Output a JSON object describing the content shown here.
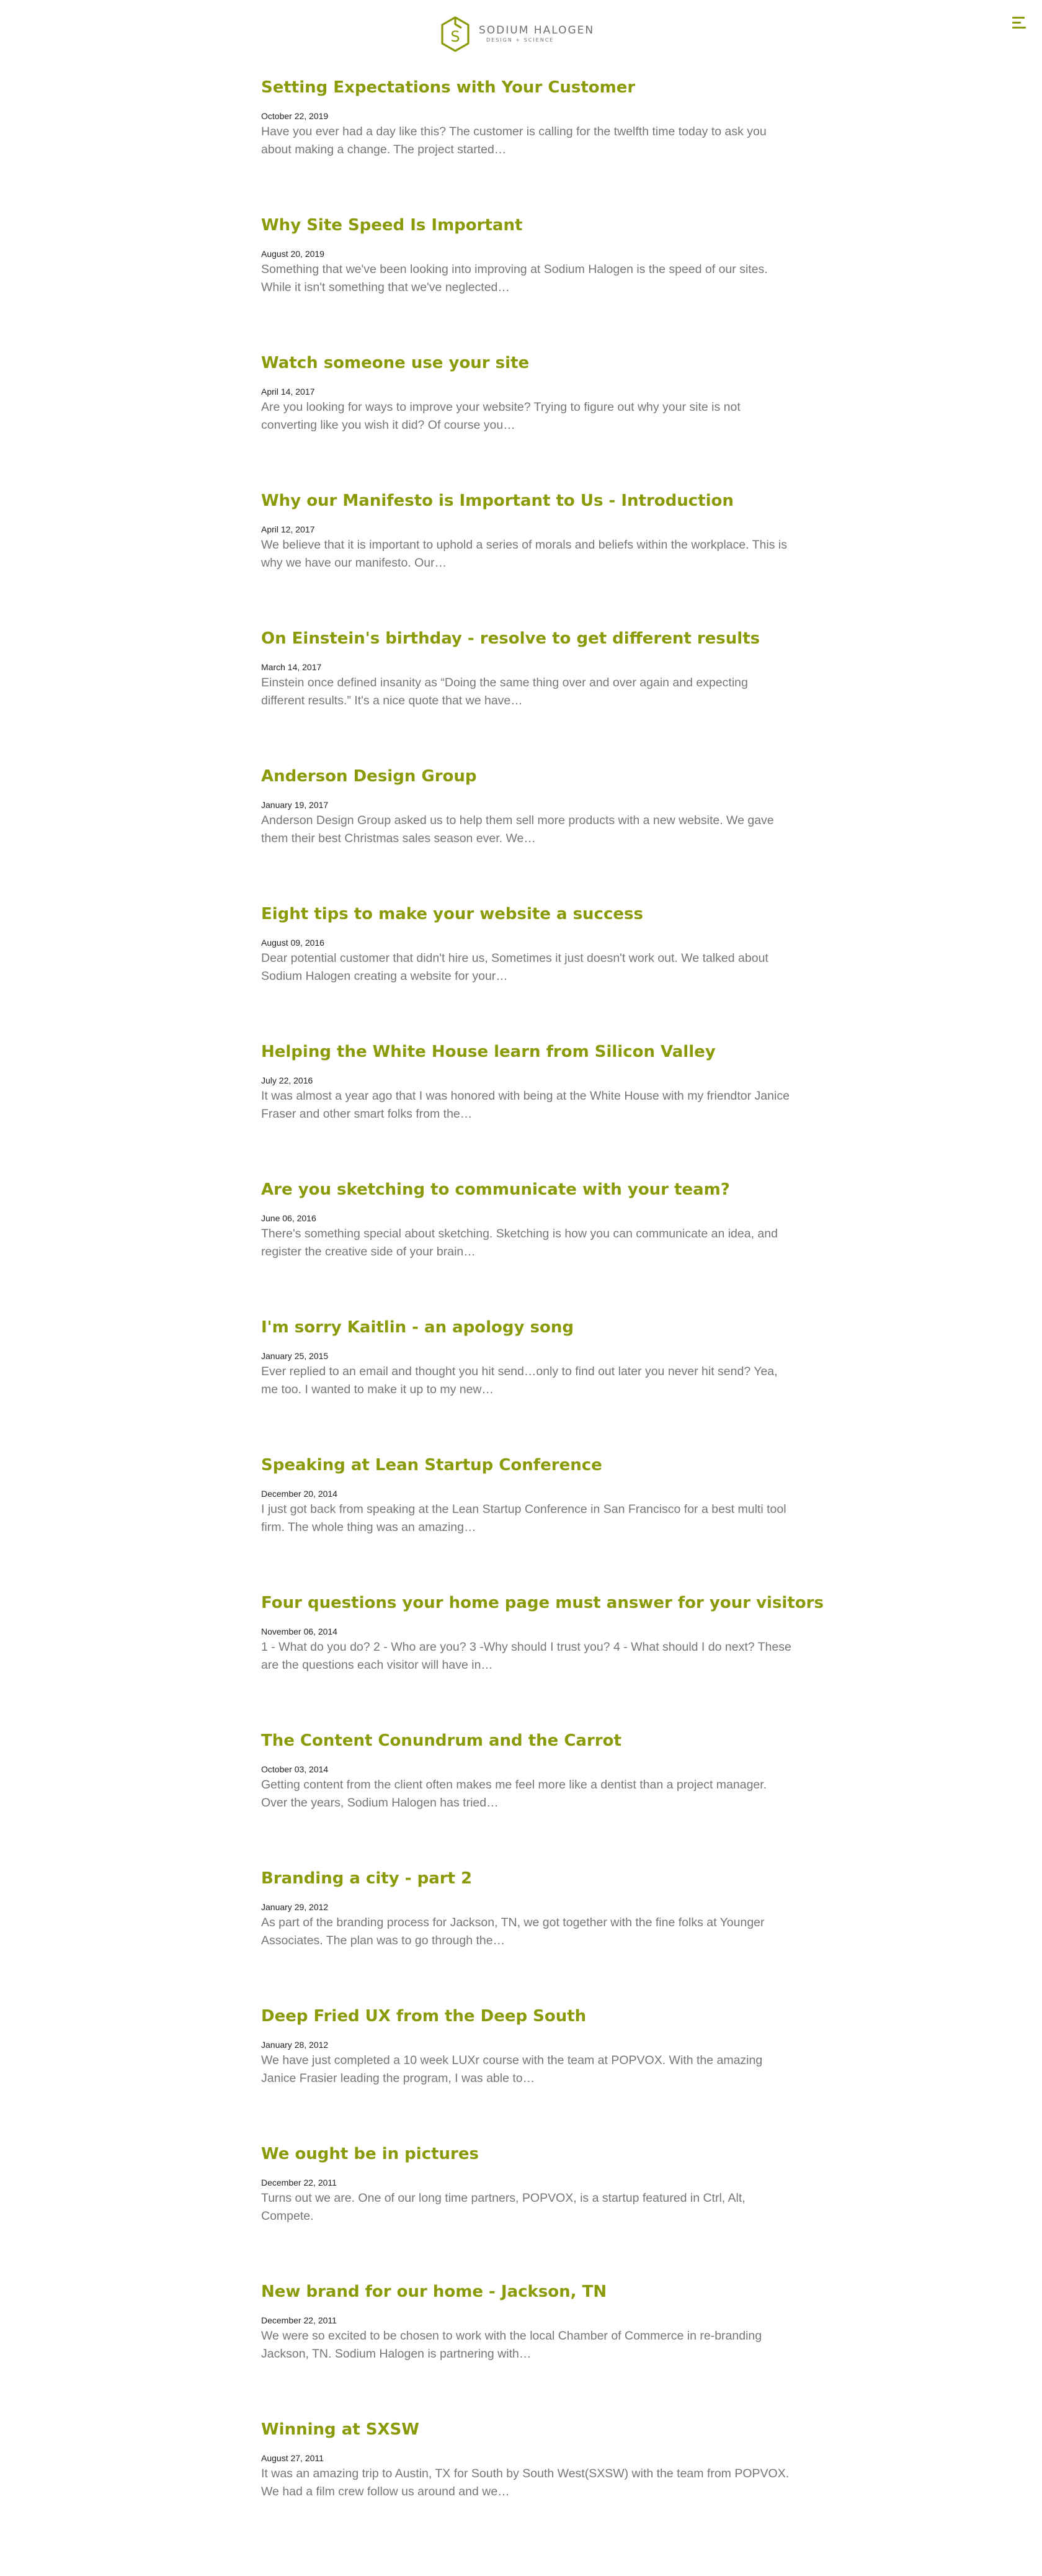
{
  "header": {
    "logo_name": "SODIUM HALOGEN",
    "logo_tagline": "DESIGN + SCIENCE",
    "logo_mark_letter": "S",
    "menu_icon": "hamburger-menu-icon",
    "accent_color": "#8a9a09"
  },
  "posts": [
    {
      "title": "Setting Expectations with Your Customer",
      "date": "October 22, 2019",
      "excerpt": "Have you ever had a day like this? The customer is calling for the twelfth time today to ask you about making a change. The project started…"
    },
    {
      "title": "Why Site Speed Is Important",
      "date": "August 20, 2019",
      "excerpt": "Something that we've been looking into improving at Sodium Halogen is the speed of our sites. While it isn't something that we've neglected…"
    },
    {
      "title": "Watch someone use your site",
      "date": "April 14, 2017",
      "excerpt": "Are you looking for ways to improve your website? Trying to figure out why your site is not converting like you wish it did? Of course you…"
    },
    {
      "title": "Why our Manifesto is Important to Us - Introduction",
      "date": "April 12, 2017",
      "excerpt": "We believe that it is important to uphold a series of morals and beliefs within the workplace. This is why we have our manifesto. Our…"
    },
    {
      "title": "On Einstein's birthday - resolve to get different results",
      "date": "March 14, 2017",
      "excerpt": "Einstein once defined insanity as “Doing the same thing over and over again and expecting different results.” It's a nice quote that we have…"
    },
    {
      "title": "Anderson Design Group",
      "date": "January 19, 2017",
      "excerpt": "Anderson Design Group asked us to help them sell more products with a new website. We gave them their best Christmas sales season ever. We…"
    },
    {
      "title": "Eight tips to make your website a success",
      "date": "August 09, 2016",
      "excerpt": "Dear potential customer that didn't hire us, Sometimes it just doesn't work out. We talked about Sodium Halogen creating a website for your…"
    },
    {
      "title": "Helping the White House learn from Silicon Valley",
      "date": "July 22, 2016",
      "excerpt": "It was almost a year ago that I was honored with being at the White House with my friendtor Janice Fraser and other smart folks from the…"
    },
    {
      "title": "Are you sketching to communicate with your team?",
      "date": "June 06, 2016",
      "excerpt": "There's something special about sketching. Sketching is how you can communicate an idea, and register the creative side of your brain…"
    },
    {
      "title": "I'm sorry Kaitlin - an apology song",
      "date": "January 25, 2015",
      "excerpt": "Ever replied to an email and thought you hit send…only to find out later you never hit send? Yea, me too. I wanted to make it up to my new…"
    },
    {
      "title": "Speaking at Lean Startup Conference",
      "date": "December 20, 2014",
      "excerpt": "I just got back from speaking at the Lean Startup Conference in San Francisco for a best multi tool firm. The whole thing was an amazing…"
    },
    {
      "title": "Four questions your home page must answer for your visitors",
      "date": "November 06, 2014",
      "excerpt": "1 - What do you do? 2 - Who are you? 3 -Why should I trust you? 4 - What should I do next? These are the questions each visitor will have in…"
    },
    {
      "title": "The Content Conundrum and the Carrot",
      "date": "October 03, 2014",
      "excerpt": "Getting content from the client often makes me feel more like a dentist than a project manager. Over the years, Sodium Halogen has tried…"
    },
    {
      "title": "Branding a city - part 2",
      "date": "January 29, 2012",
      "excerpt": "As part of the branding process for Jackson, TN, we got together with the fine folks at Younger Associates. The plan was to go through the…"
    },
    {
      "title": "Deep Fried UX from the Deep South",
      "date": "January 28, 2012",
      "excerpt": "We have just completed a 10 week LUXr course with the team at POPVOX. With the amazing Janice Frasier leading the program, I was able to…"
    },
    {
      "title": "We ought be in pictures",
      "date": "December 22, 2011",
      "excerpt": "Turns out we are. One of our long time partners, POPVOX, is a startup featured in Ctrl, Alt, Compete."
    },
    {
      "title": "New brand for our home - Jackson, TN",
      "date": "December 22, 2011",
      "excerpt": "We were so excited to be chosen to work with the local Chamber of Commerce in re-branding Jackson, TN. Sodium Halogen is partnering with…"
    },
    {
      "title": "Winning at SXSW",
      "date": "August 27, 2011",
      "excerpt": "It was an amazing trip to Austin, TX for South by South West(SXSW) with the team from POPVOX. We had a film crew follow us around and we…"
    }
  ]
}
